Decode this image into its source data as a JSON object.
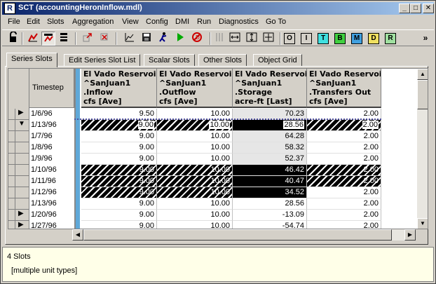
{
  "window": {
    "title": "SCT  (accountingHeronInflow.mdl)",
    "app_icon": "R",
    "buttons": {
      "minimize": "_",
      "maximize": "□",
      "close": "✕"
    }
  },
  "menu": [
    "File",
    "Edit",
    "Slots",
    "Aggregation",
    "View",
    "Config",
    "DMI",
    "Run",
    "Diagnostics",
    "Go To"
  ],
  "toolbar": {
    "icons": [
      "lock-icon",
      "series-slot-icon",
      "series-slot-selected-icon",
      "column-list-icon",
      "move-icon",
      "delete-icon",
      "plot-icon",
      "save-icon",
      "run-icon",
      "play-icon",
      "stop-icon"
    ],
    "letter_buttons": [
      {
        "label": "O",
        "color": "#ffffff"
      },
      {
        "label": "I",
        "color": "#ffffff"
      },
      {
        "label": "T",
        "color": "#40e0e0"
      },
      {
        "label": "B",
        "color": "#40d040"
      },
      {
        "label": "M",
        "color": "#40a0e0"
      },
      {
        "label": "D",
        "color": "#f0e060"
      },
      {
        "label": "R",
        "color": "#a0e0a0"
      }
    ],
    "overflow": "»"
  },
  "tabs": [
    "Series Slots",
    "Edit Series Slot List",
    "Scalar Slots",
    "Other Slots",
    "Object Grid"
  ],
  "active_tab": 0,
  "grid": {
    "timestep_header": "Timestep",
    "columns": [
      {
        "lines": [
          "El Vado Reservoir",
          "^SanJuan1",
          ".Inflow",
          "cfs [Ave]"
        ]
      },
      {
        "lines": [
          "El Vado Reservoir",
          "^SanJuan1",
          ".Outflow",
          "cfs [Ave]"
        ]
      },
      {
        "lines": [
          "El Vado Reservoir",
          "^SanJuan1",
          ".Storage",
          "acre-ft [Last]"
        ]
      },
      {
        "lines": [
          "El Vado Reservoir",
          "^SanJuan1",
          ".Transfers Out",
          "cfs [Ave]"
        ]
      }
    ],
    "rows": [
      {
        "ts": "1/6/96",
        "mark": "▶",
        "values": [
          "9.50",
          "10.00",
          "70.23",
          "2.00"
        ]
      },
      {
        "ts": "1/13/96",
        "mark": "▼",
        "values": [
          "9.00",
          "10.00",
          "28.56",
          "2.00"
        ]
      },
      {
        "ts": "1/7/96",
        "mark": "",
        "values": [
          "9.00",
          "10.00",
          "64.28",
          "2.00"
        ]
      },
      {
        "ts": "1/8/96",
        "mark": "",
        "values": [
          "9.00",
          "10.00",
          "58.32",
          "2.00"
        ]
      },
      {
        "ts": "1/9/96",
        "mark": "",
        "values": [
          "9.00",
          "10.00",
          "52.37",
          "2.00"
        ]
      },
      {
        "ts": "1/10/96",
        "mark": "",
        "values": [
          "9.00",
          "10.00",
          "46.42",
          "2.00"
        ]
      },
      {
        "ts": "1/11/96",
        "mark": "",
        "values": [
          "9.00",
          "10.00",
          "40.47",
          "2.00"
        ]
      },
      {
        "ts": "1/12/96",
        "mark": "",
        "values": [
          "9.00",
          "10.00",
          "34.52",
          "2.00"
        ]
      },
      {
        "ts": "1/13/96",
        "mark": "",
        "values": [
          "9.00",
          "10.00",
          "28.56",
          "2.00"
        ]
      },
      {
        "ts": "1/20/96",
        "mark": "▶",
        "values": [
          "9.00",
          "10.00",
          "-13.09",
          "2.00"
        ]
      },
      {
        "ts": "1/27/96",
        "mark": "▶",
        "values": [
          "9.00",
          "10.00",
          "-54.74",
          "2.00"
        ]
      }
    ]
  },
  "status": {
    "line1": "4 Slots",
    "line2": "[multiple unit types]"
  }
}
